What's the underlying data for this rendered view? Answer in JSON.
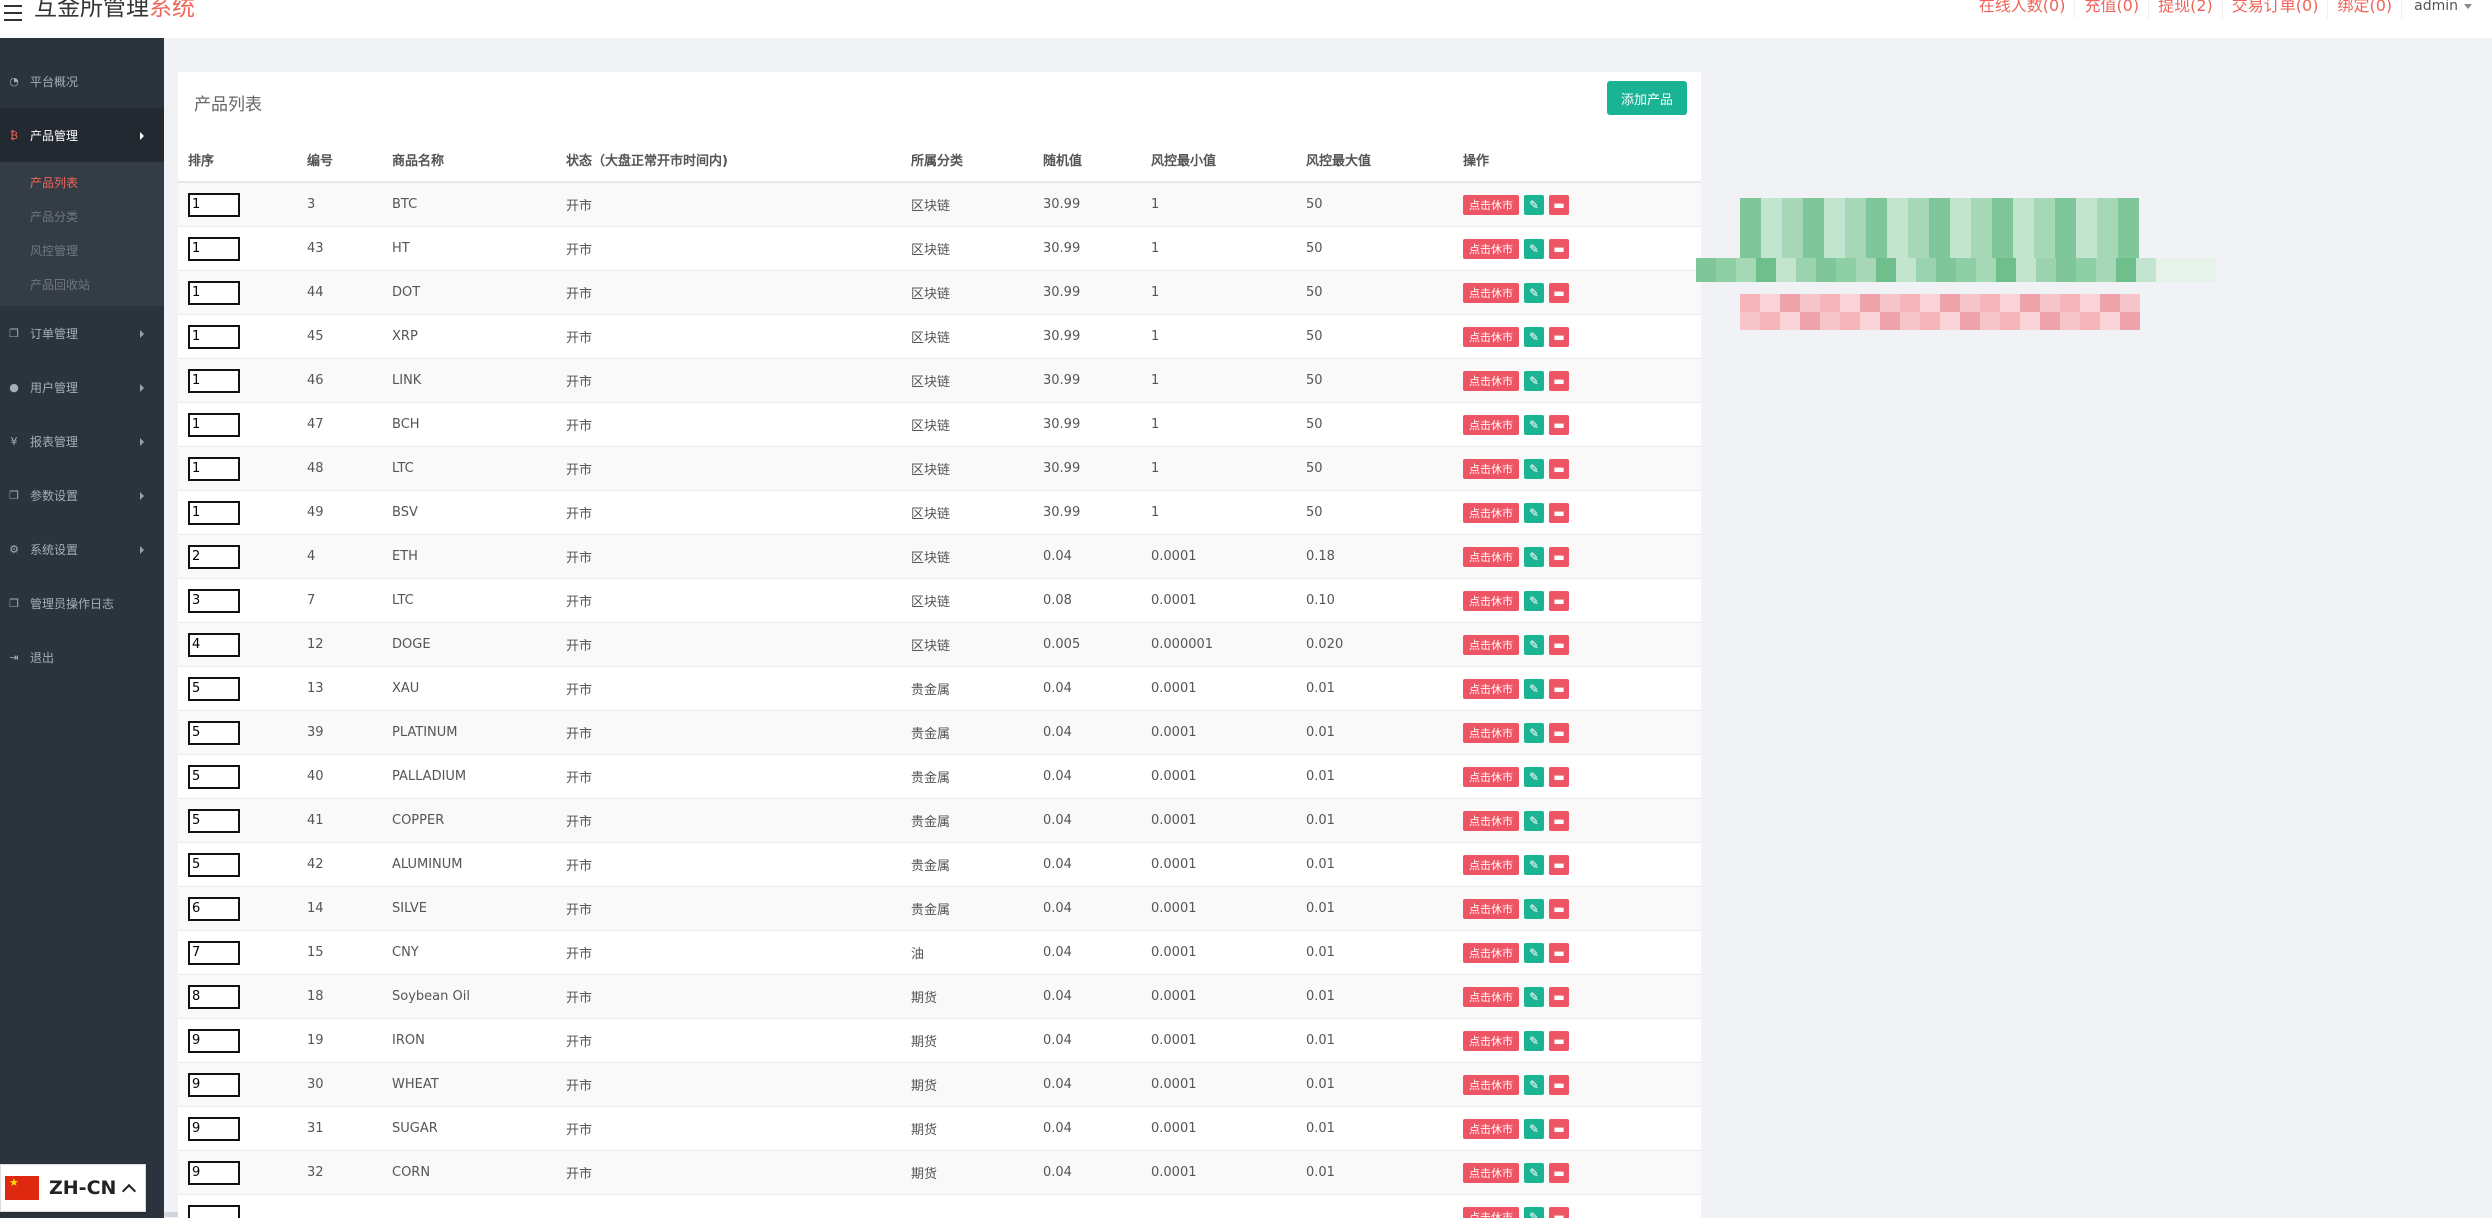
{
  "header": {
    "title_main": "互金所管理",
    "title_accent": "系统",
    "links": [
      "在线人数(0)",
      "充值(0)",
      "提现(2)",
      "交易订单(0)",
      "绑定(0)"
    ],
    "user": "admin"
  },
  "sidebar": {
    "items": [
      {
        "label": "平台概况",
        "icon": "dashboard-icon",
        "glyph": "◔",
        "arrow": false,
        "active": false
      },
      {
        "label": "产品管理",
        "icon": "bitcoin-icon",
        "glyph": "₿",
        "arrow": true,
        "active": true
      },
      {
        "label": "订单管理",
        "icon": "copy-icon",
        "glyph": "❐",
        "arrow": true,
        "active": false
      },
      {
        "label": "用户管理",
        "icon": "user-icon",
        "glyph": "●",
        "arrow": true,
        "active": false
      },
      {
        "label": "报表管理",
        "icon": "yen-icon",
        "glyph": "¥",
        "arrow": true,
        "active": false
      },
      {
        "label": "参数设置",
        "icon": "copy-icon",
        "glyph": "❐",
        "arrow": true,
        "active": false
      },
      {
        "label": "系统设置",
        "icon": "cogs-icon",
        "glyph": "⚙",
        "arrow": true,
        "active": false
      },
      {
        "label": "管理员操作日志",
        "icon": "copy-icon",
        "glyph": "❐",
        "arrow": false,
        "active": false
      },
      {
        "label": "退出",
        "icon": "sign-out-icon",
        "glyph": "⇥",
        "arrow": false,
        "active": false
      }
    ],
    "subitems": [
      "产品列表",
      "产品分类",
      "风控管理",
      "产品回收站"
    ],
    "current_sub": 0
  },
  "lang": {
    "label": "ZH-CN"
  },
  "panel": {
    "title": "产品列表",
    "add_button": "添加产品",
    "columns": [
      "排序",
      "编号",
      "商品名称",
      "状态（大盘正常开市时间内)",
      "所属分类",
      "随机值",
      "风控最小值",
      "风控最大值",
      "操作"
    ],
    "halt_label": "点击休市",
    "rows": [
      {
        "sort": "1",
        "id": "3",
        "name": "BTC",
        "status": "开市",
        "category": "区块链",
        "random": "30.99",
        "min": "1",
        "max": "50"
      },
      {
        "sort": "1",
        "id": "43",
        "name": "HT",
        "status": "开市",
        "category": "区块链",
        "random": "30.99",
        "min": "1",
        "max": "50"
      },
      {
        "sort": "1",
        "id": "44",
        "name": "DOT",
        "status": "开市",
        "category": "区块链",
        "random": "30.99",
        "min": "1",
        "max": "50"
      },
      {
        "sort": "1",
        "id": "45",
        "name": "XRP",
        "status": "开市",
        "category": "区块链",
        "random": "30.99",
        "min": "1",
        "max": "50"
      },
      {
        "sort": "1",
        "id": "46",
        "name": "LINK",
        "status": "开市",
        "category": "区块链",
        "random": "30.99",
        "min": "1",
        "max": "50"
      },
      {
        "sort": "1",
        "id": "47",
        "name": "BCH",
        "status": "开市",
        "category": "区块链",
        "random": "30.99",
        "min": "1",
        "max": "50"
      },
      {
        "sort": "1",
        "id": "48",
        "name": "LTC",
        "status": "开市",
        "category": "区块链",
        "random": "30.99",
        "min": "1",
        "max": "50"
      },
      {
        "sort": "1",
        "id": "49",
        "name": "BSV",
        "status": "开市",
        "category": "区块链",
        "random": "30.99",
        "min": "1",
        "max": "50"
      },
      {
        "sort": "2",
        "id": "4",
        "name": "ETH",
        "status": "开市",
        "category": "区块链",
        "random": "0.04",
        "min": "0.0001",
        "max": "0.18"
      },
      {
        "sort": "3",
        "id": "7",
        "name": "LTC",
        "status": "开市",
        "category": "区块链",
        "random": "0.08",
        "min": "0.0001",
        "max": "0.10"
      },
      {
        "sort": "4",
        "id": "12",
        "name": "DOGE",
        "status": "开市",
        "category": "区块链",
        "random": "0.005",
        "min": "0.000001",
        "max": "0.020"
      },
      {
        "sort": "5",
        "id": "13",
        "name": "XAU",
        "status": "开市",
        "category": "贵金属",
        "random": "0.04",
        "min": "0.0001",
        "max": "0.01"
      },
      {
        "sort": "5",
        "id": "39",
        "name": "PLATINUM",
        "status": "开市",
        "category": "贵金属",
        "random": "0.04",
        "min": "0.0001",
        "max": "0.01"
      },
      {
        "sort": "5",
        "id": "40",
        "name": "PALLADIUM",
        "status": "开市",
        "category": "贵金属",
        "random": "0.04",
        "min": "0.0001",
        "max": "0.01"
      },
      {
        "sort": "5",
        "id": "41",
        "name": "COPPER",
        "status": "开市",
        "category": "贵金属",
        "random": "0.04",
        "min": "0.0001",
        "max": "0.01"
      },
      {
        "sort": "5",
        "id": "42",
        "name": "ALUMINUM",
        "status": "开市",
        "category": "贵金属",
        "random": "0.04",
        "min": "0.0001",
        "max": "0.01"
      },
      {
        "sort": "6",
        "id": "14",
        "name": "SILVE",
        "status": "开市",
        "category": "贵金属",
        "random": "0.04",
        "min": "0.0001",
        "max": "0.01"
      },
      {
        "sort": "7",
        "id": "15",
        "name": "CNY",
        "status": "开市",
        "category": "油",
        "random": "0.04",
        "min": "0.0001",
        "max": "0.01"
      },
      {
        "sort": "8",
        "id": "18",
        "name": "Soybean Oil",
        "status": "开市",
        "category": "期货",
        "random": "0.04",
        "min": "0.0001",
        "max": "0.01"
      },
      {
        "sort": "9",
        "id": "19",
        "name": "IRON",
        "status": "开市",
        "category": "期货",
        "random": "0.04",
        "min": "0.0001",
        "max": "0.01"
      },
      {
        "sort": "9",
        "id": "30",
        "name": "WHEAT",
        "status": "开市",
        "category": "期货",
        "random": "0.04",
        "min": "0.0001",
        "max": "0.01"
      },
      {
        "sort": "9",
        "id": "31",
        "name": "SUGAR",
        "status": "开市",
        "category": "期货",
        "random": "0.04",
        "min": "0.0001",
        "max": "0.01"
      },
      {
        "sort": "9",
        "id": "32",
        "name": "CORN",
        "status": "开市",
        "category": "期货",
        "random": "0.04",
        "min": "0.0001",
        "max": "0.01"
      },
      {
        "sort": "",
        "id": "",
        "name": "",
        "status": "",
        "category": "",
        "random": "",
        "min": "",
        "max": ""
      }
    ]
  },
  "colors": {
    "accent_red": "#f0655a",
    "button_green": "#1ab394",
    "button_red": "#ed5565",
    "sidebar_bg": "#2b333d"
  }
}
